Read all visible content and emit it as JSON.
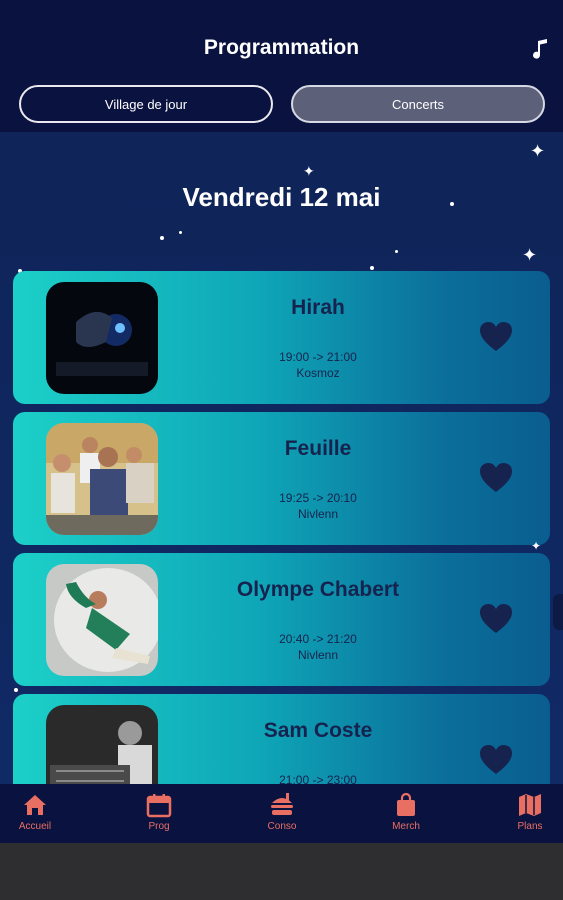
{
  "header": {
    "title": "Programmation",
    "music_icon": "music-note-icon"
  },
  "tabs": [
    {
      "label": "Village de jour",
      "selected": false
    },
    {
      "label": "Concerts",
      "selected": true
    }
  ],
  "day": "Vendredi 12 mai",
  "concerts": [
    {
      "artist": "Hirah",
      "time": "19:00 -> 21:00",
      "venue": "Kosmoz"
    },
    {
      "artist": "Feuille",
      "time": "19:25 -> 20:10",
      "venue": "Nivlenn"
    },
    {
      "artist": "Olympe Chabert",
      "time": "20:40 -> 21:20",
      "venue": "Nivlenn"
    },
    {
      "artist": "Sam Coste",
      "time": "21:00 -> 23:00",
      "venue": ""
    }
  ],
  "nav": [
    {
      "label": "Accueil",
      "icon": "home-icon"
    },
    {
      "label": "Prog",
      "icon": "calendar-icon"
    },
    {
      "label": "Conso",
      "icon": "burger-icon"
    },
    {
      "label": "Merch",
      "icon": "shopping-bag-icon"
    },
    {
      "label": "Plans",
      "icon": "map-icon"
    }
  ],
  "colors": {
    "accent": "#ea6f63",
    "header_bg": "#0a1240",
    "card_start": "#1cd0c8",
    "card_end": "#0a5d8f",
    "text_dark": "#16234e"
  }
}
